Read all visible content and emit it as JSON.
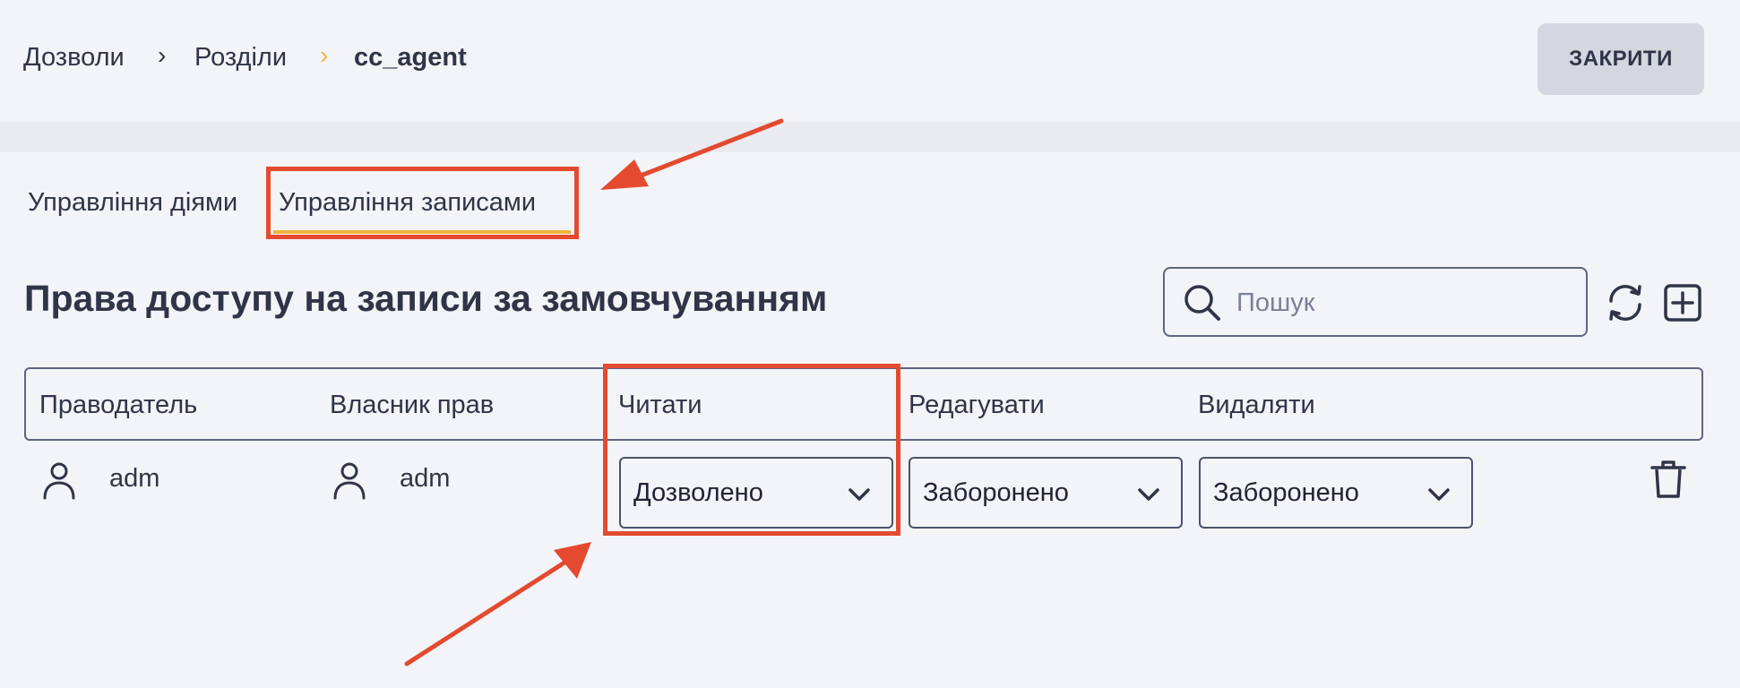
{
  "breadcrumb": {
    "items": [
      "Дозволи",
      "Розділи"
    ],
    "current": "cc_agent",
    "separator": "›"
  },
  "header": {
    "close_label": "ЗАКРИТИ"
  },
  "tabs": [
    {
      "label": "Управління діями",
      "active": false
    },
    {
      "label": "Управління записами",
      "active": true
    }
  ],
  "page_title": "Права доступу на записи за замовчуванням",
  "search": {
    "placeholder": "Пошук",
    "value": ""
  },
  "table": {
    "columns": [
      "Праводатель",
      "Власник прав",
      "Читати",
      "Редагувати",
      "Видаляти"
    ],
    "rows": [
      {
        "grantor": "adm",
        "grantee": "adm",
        "read": "Дозволено",
        "edit": "Заборонено",
        "delete": "Заборонено"
      }
    ]
  },
  "icons": {
    "search": "search-icon",
    "refresh": "refresh-icon",
    "add": "add-icon",
    "user": "user-icon",
    "chevron": "chevron-down-icon",
    "delete": "trash-icon"
  },
  "colors": {
    "accent_underline": "#f2b33d",
    "annotation": "#e34a2f",
    "text": "#2f3547",
    "background": "#f3f4f8"
  }
}
